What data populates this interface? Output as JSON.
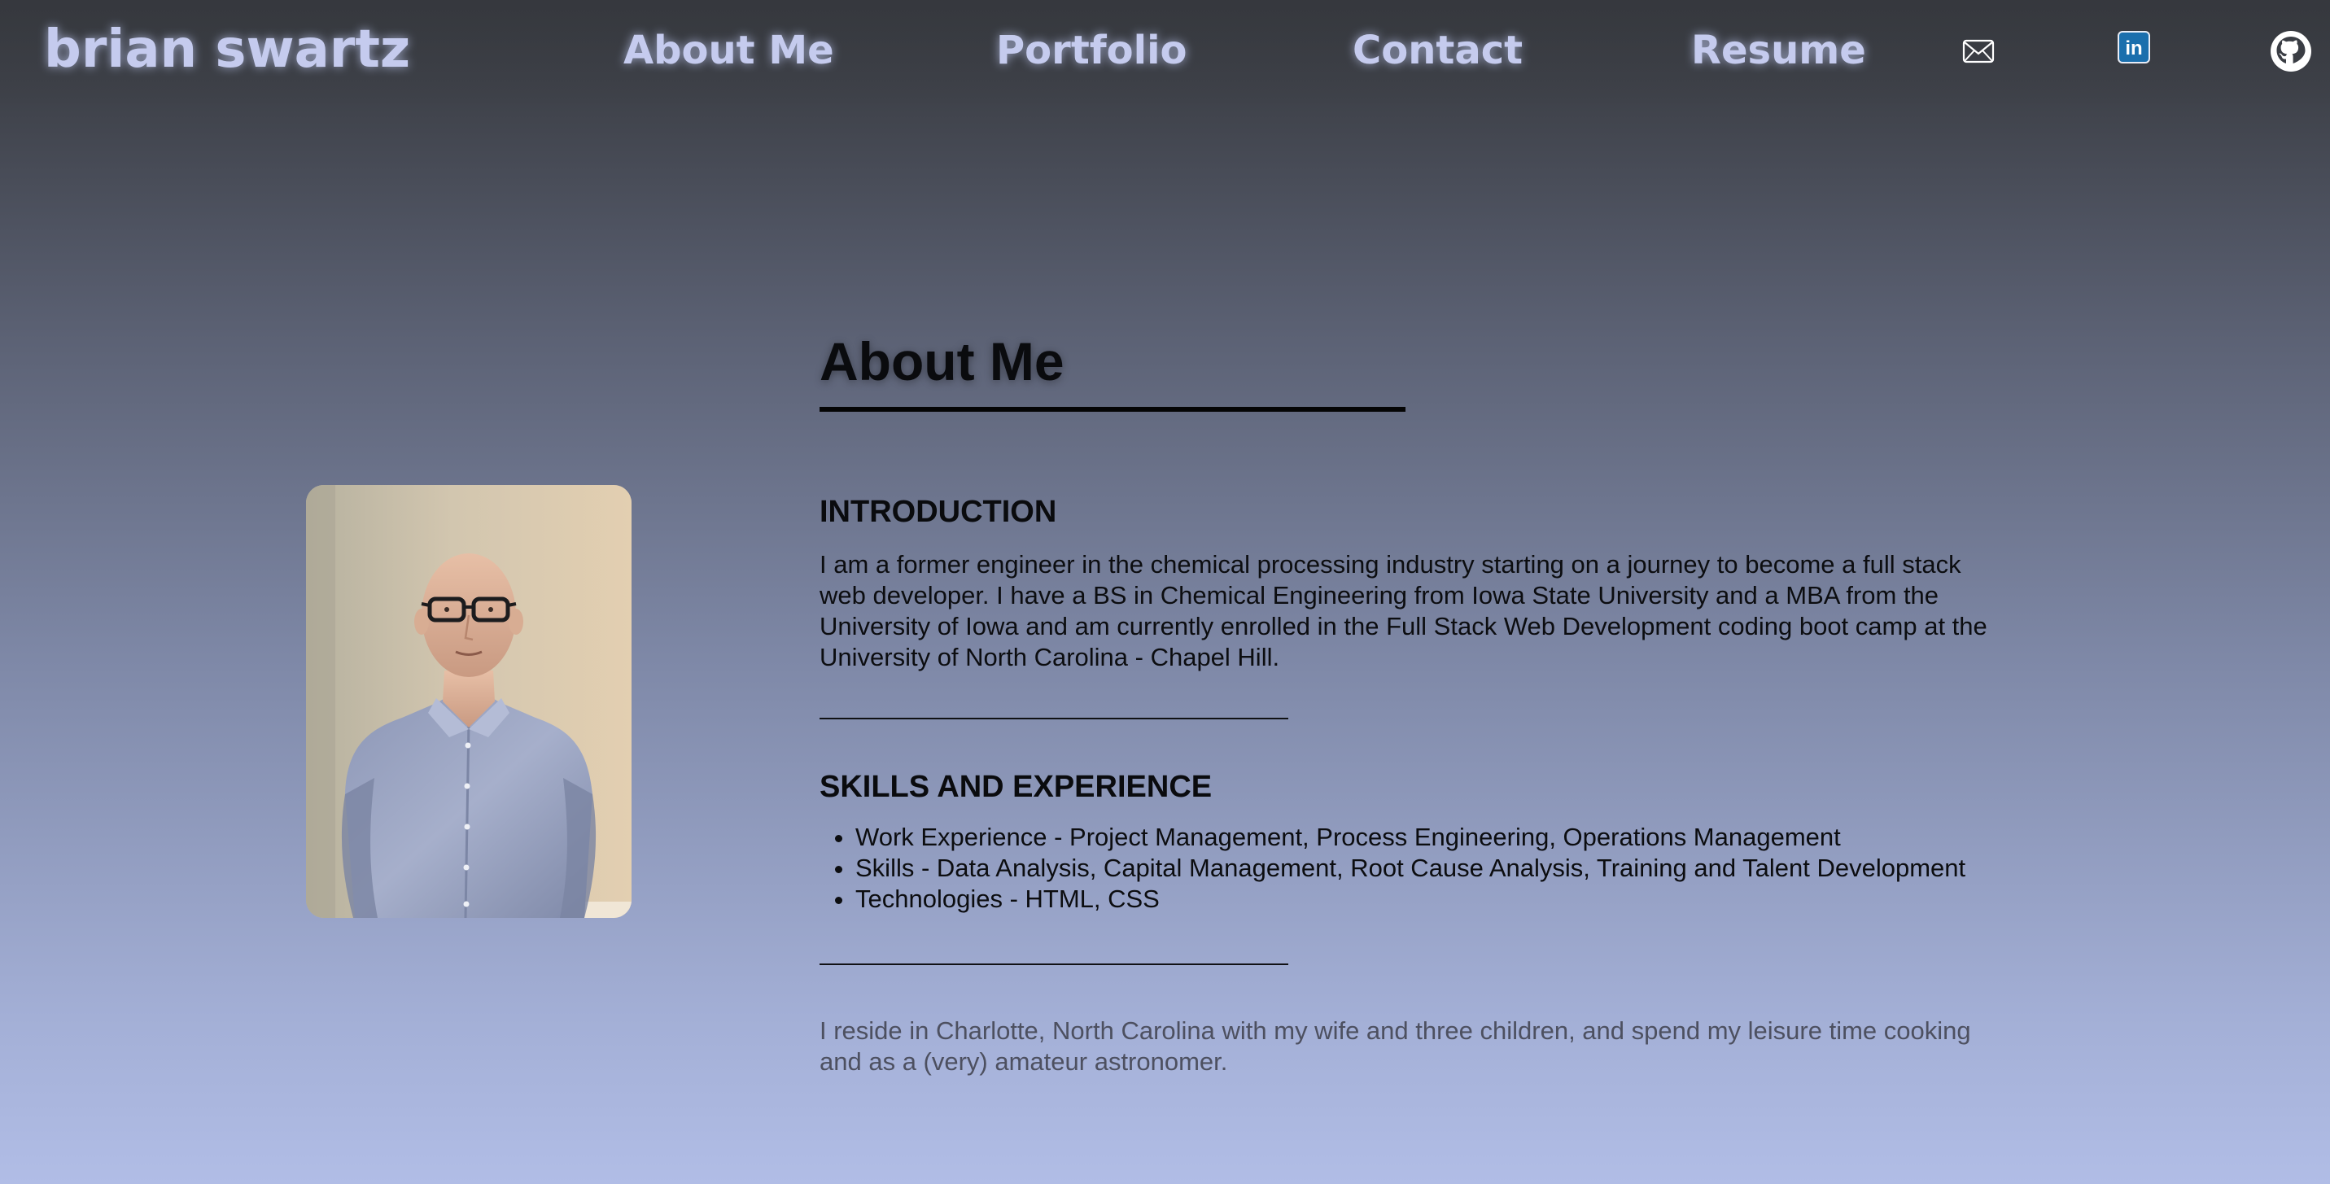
{
  "header": {
    "brand": "brian swartz",
    "nav": {
      "about": "About Me",
      "portfolio": "Portfolio",
      "contact": "Contact",
      "resume": "Resume"
    },
    "icons": [
      "mail-icon",
      "linkedin-icon",
      "github-icon"
    ],
    "linkedin_glyph": "in",
    "accent_color": "#c5cbee"
  },
  "main": {
    "title": "About Me",
    "introduction": {
      "heading": "INTRODUCTION",
      "text": "I am a former engineer in the chemical processing industry starting on a journey to become a full stack web developer. I have a BS in Chemical Engineering from Iowa State University and a MBA from the University of Iowa and am currently enrolled in the Full Stack Web Development coding boot camp at the University of North Carolina - Chapel Hill."
    },
    "skills": {
      "heading": "SKILLS AND EXPERIENCE",
      "items": [
        "Work Experience - Project Management, Process Engineering, Operations Management",
        "Skills - Data Analysis, Capital Management, Root Cause Analysis, Training and Talent Development",
        "Technologies - HTML, CSS"
      ]
    },
    "personal": "I reside in Charlotte, North Carolina with my wife and three children, and spend my leisure time cooking and as a (very) amateur astronomer."
  }
}
